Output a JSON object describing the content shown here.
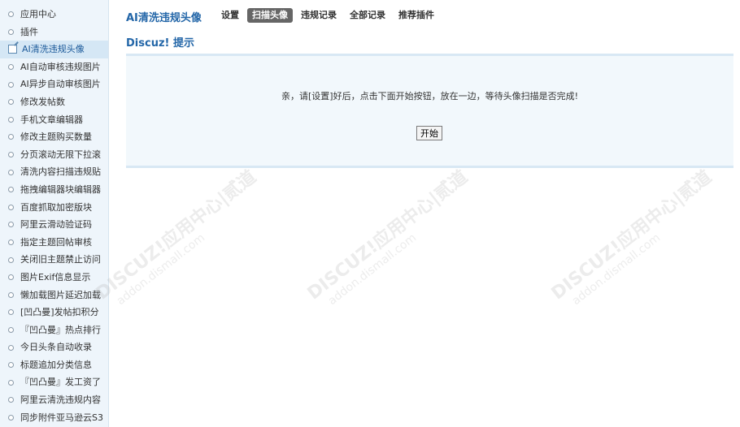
{
  "sidebar": {
    "items": [
      {
        "label": "应用中心"
      },
      {
        "label": "插件"
      },
      {
        "label": "AI清洗违规头像",
        "active": true
      },
      {
        "label": "AI自动审核违规图片"
      },
      {
        "label": "AI异步自动审核图片"
      },
      {
        "label": "修改发帖数"
      },
      {
        "label": "手机文章编辑器"
      },
      {
        "label": "修改主题购买数量"
      },
      {
        "label": "分页滚动无限下拉滚"
      },
      {
        "label": "清洗内容扫描违规贴"
      },
      {
        "label": "拖拽编辑器块编辑器"
      },
      {
        "label": "百度抓取加密版块"
      },
      {
        "label": "阿里云滑动验证码"
      },
      {
        "label": "指定主题回帖审核"
      },
      {
        "label": "关闭旧主题禁止访问"
      },
      {
        "label": "图片Exif信息显示"
      },
      {
        "label": "懒加载图片延迟加载"
      },
      {
        "label": "[凹凸曼]发帖扣积分"
      },
      {
        "label": "『凹凸曼』热点排行"
      },
      {
        "label": "今日头条自动收录"
      },
      {
        "label": "标题追加分类信息"
      },
      {
        "label": "『凹凸曼』发工资了"
      },
      {
        "label": "阿里云清洗违规内容"
      },
      {
        "label": "同步附件亚马逊云S3"
      }
    ]
  },
  "header": {
    "title": "AI清洗违规头像",
    "tabs": [
      {
        "label": "设置"
      },
      {
        "label": "扫描头像",
        "active": true
      },
      {
        "label": "违规记录"
      },
      {
        "label": "全部记录"
      },
      {
        "label": "推荐插件"
      }
    ]
  },
  "main": {
    "section_title": "Discuz! 提示",
    "message": "亲，请[设置]好后，点击下面开始按钮，放在一边，等待头像扫描是否完成!",
    "start_label": "开始"
  },
  "watermarks": [
    {
      "text": "DISCUZ!应用中心|贰道",
      "sub": "addon.dismall.com"
    },
    {
      "text": "DISCUZ!应用中心|贰道",
      "sub": "addon.dismall.com"
    },
    {
      "text": "DISCUZ!应用中心|贰道",
      "sub": "addon.dismall.com"
    }
  ],
  "colors": {
    "accent": "#2366a8",
    "sidebar_bg": "#eef5fb",
    "active_tab_bg": "#666666",
    "msgbox_bg": "#f2f8fc"
  }
}
